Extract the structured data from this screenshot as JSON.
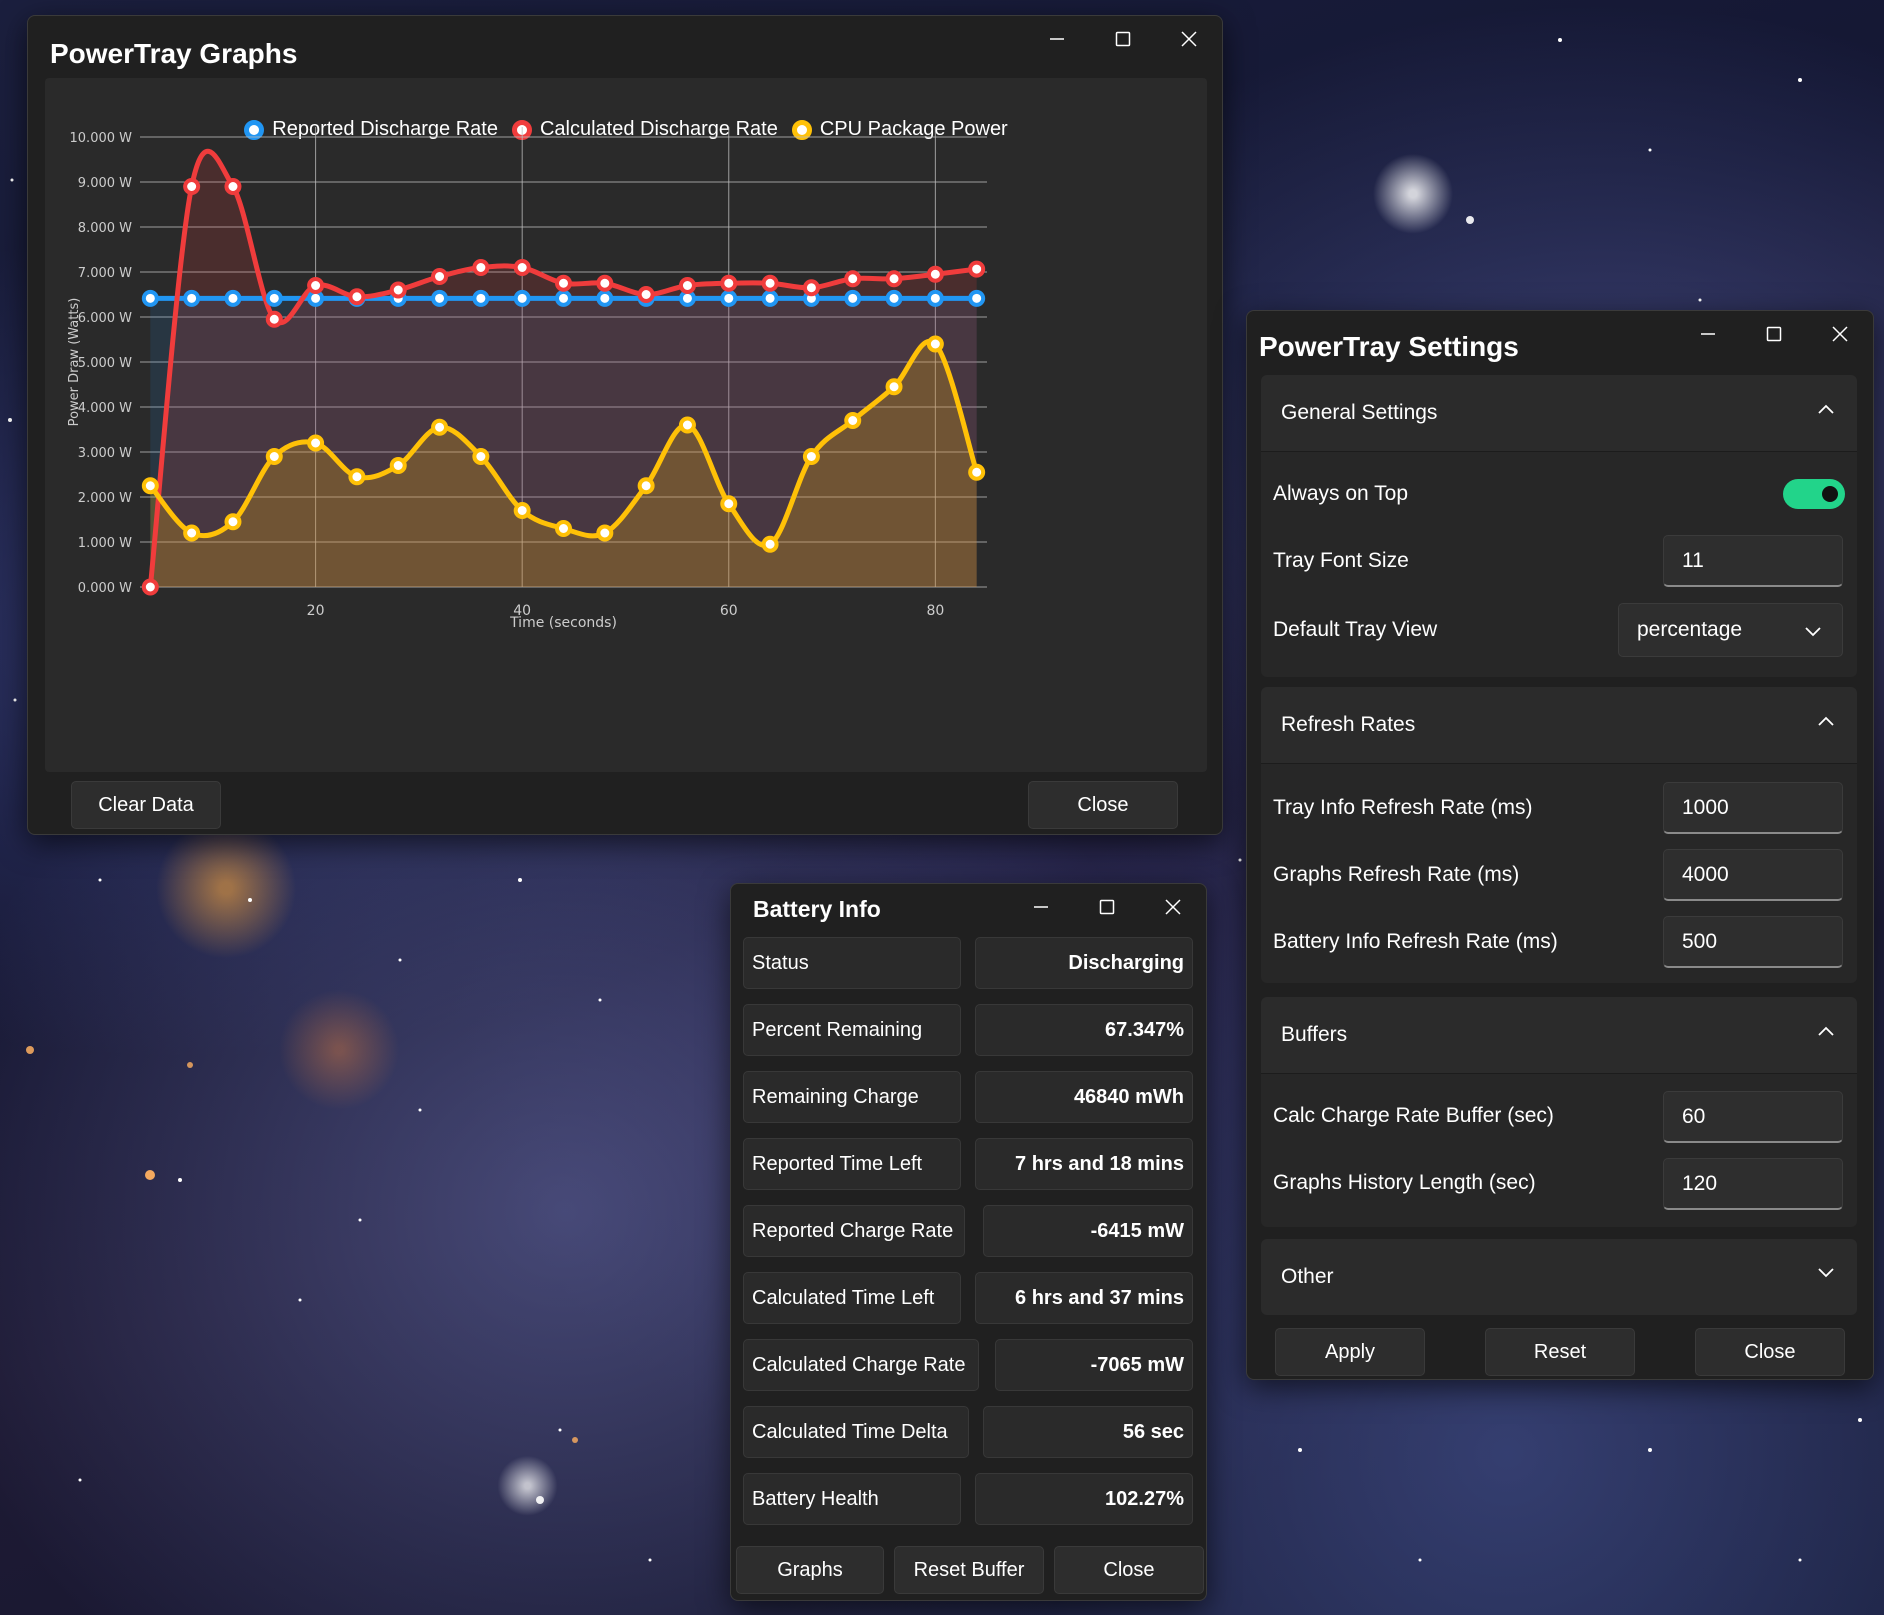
{
  "graphs_window": {
    "title": "PowerTray Graphs",
    "clear_label": "Clear Data",
    "close_label": "Close"
  },
  "chart_data": {
    "type": "line",
    "title": "",
    "xlabel": "Time (seconds)",
    "ylabel": "Power Draw (Watts)",
    "xlim": [
      3,
      85
    ],
    "ylim": [
      0,
      10
    ],
    "x_ticks": [
      20,
      40,
      60,
      80
    ],
    "y_tick_labels": [
      "0.000 W",
      "1.000 W",
      "2.000 W",
      "3.000 W",
      "4.000 W",
      "5.000 W",
      "6.000 W",
      "7.000 W",
      "8.000 W",
      "9.000 W",
      "10.000 W"
    ],
    "grid": true,
    "legend_position": "top",
    "x": [
      4,
      8,
      12,
      16,
      20,
      24,
      28,
      32,
      36,
      40,
      44,
      48,
      52,
      56,
      60,
      64,
      68,
      72,
      76,
      80,
      84
    ],
    "series": [
      {
        "name": "Reported Discharge Rate",
        "color": "#2196f3",
        "fill": "rgba(33,150,243,0.12)",
        "values": [
          6.415,
          6.415,
          6.415,
          6.415,
          6.415,
          6.415,
          6.415,
          6.415,
          6.415,
          6.415,
          6.415,
          6.415,
          6.415,
          6.415,
          6.415,
          6.415,
          6.415,
          6.415,
          6.415,
          6.415,
          6.415
        ]
      },
      {
        "name": "Calculated Discharge Rate",
        "color": "#f03c3c",
        "fill": "rgba(240,60,60,0.16)",
        "values": [
          0.0,
          8.9,
          8.9,
          5.95,
          6.7,
          6.45,
          6.6,
          6.9,
          7.1,
          7.1,
          6.75,
          6.75,
          6.5,
          6.7,
          6.75,
          6.75,
          6.65,
          6.85,
          6.85,
          6.95,
          7.065
        ]
      },
      {
        "name": "CPU Package Power",
        "color": "#ffc107",
        "fill": "rgba(255,193,7,0.22)",
        "values": [
          2.25,
          1.2,
          1.45,
          2.9,
          3.2,
          2.45,
          2.7,
          3.55,
          2.9,
          1.7,
          1.3,
          1.2,
          2.25,
          3.6,
          1.85,
          0.95,
          2.9,
          3.7,
          4.45,
          5.4,
          2.55
        ]
      }
    ]
  },
  "settings_window": {
    "title": "PowerTray Settings",
    "general": {
      "header": "General Settings",
      "always_on_top_label": "Always on Top",
      "always_on_top": "on",
      "font_size_label": "Tray Font Size",
      "font_size": "11",
      "tray_view_label": "Default Tray View",
      "tray_view": "percentage"
    },
    "refresh": {
      "header": "Refresh Rates",
      "tray_label": "Tray Info Refresh Rate (ms)",
      "tray_value": "1000",
      "graphs_label": "Graphs Refresh Rate (ms)",
      "graphs_value": "4000",
      "battery_label": "Battery Info Refresh Rate (ms)",
      "battery_value": "500"
    },
    "buffers": {
      "header": "Buffers",
      "calc_label": "Calc Charge Rate Buffer (sec)",
      "calc_value": "60",
      "history_label": "Graphs History Length (sec)",
      "history_value": "120"
    },
    "other": {
      "header": "Other"
    },
    "apply_label": "Apply",
    "reset_label": "Reset",
    "close_label": "Close"
  },
  "battery_window": {
    "title": "Battery Info",
    "rows": [
      {
        "label": "Status",
        "value": "Discharging"
      },
      {
        "label": "Percent Remaining",
        "value": "67.347%"
      },
      {
        "label": "Remaining Charge",
        "value": "46840 mWh"
      },
      {
        "label": "Reported Time Left",
        "value": "7 hrs and 18 mins"
      },
      {
        "label": "Reported Charge Rate",
        "value": "-6415 mW"
      },
      {
        "label": "Calculated Time Left",
        "value": "6 hrs and 37 mins"
      },
      {
        "label": "Calculated Charge Rate",
        "value": "-7065 mW"
      },
      {
        "label": "Calculated Time Delta",
        "value": "56 sec"
      },
      {
        "label": "Battery Health",
        "value": "102.27%"
      }
    ],
    "graphs_label": "Graphs",
    "reset_buffer_label": "Reset Buffer",
    "close_label": "Close"
  },
  "colors": {
    "toggle_on": "#22d48a",
    "window_bg": "#202020",
    "reported_series": "#2196f3",
    "calculated_series": "#f03c3c",
    "cpu_series": "#ffc107"
  }
}
